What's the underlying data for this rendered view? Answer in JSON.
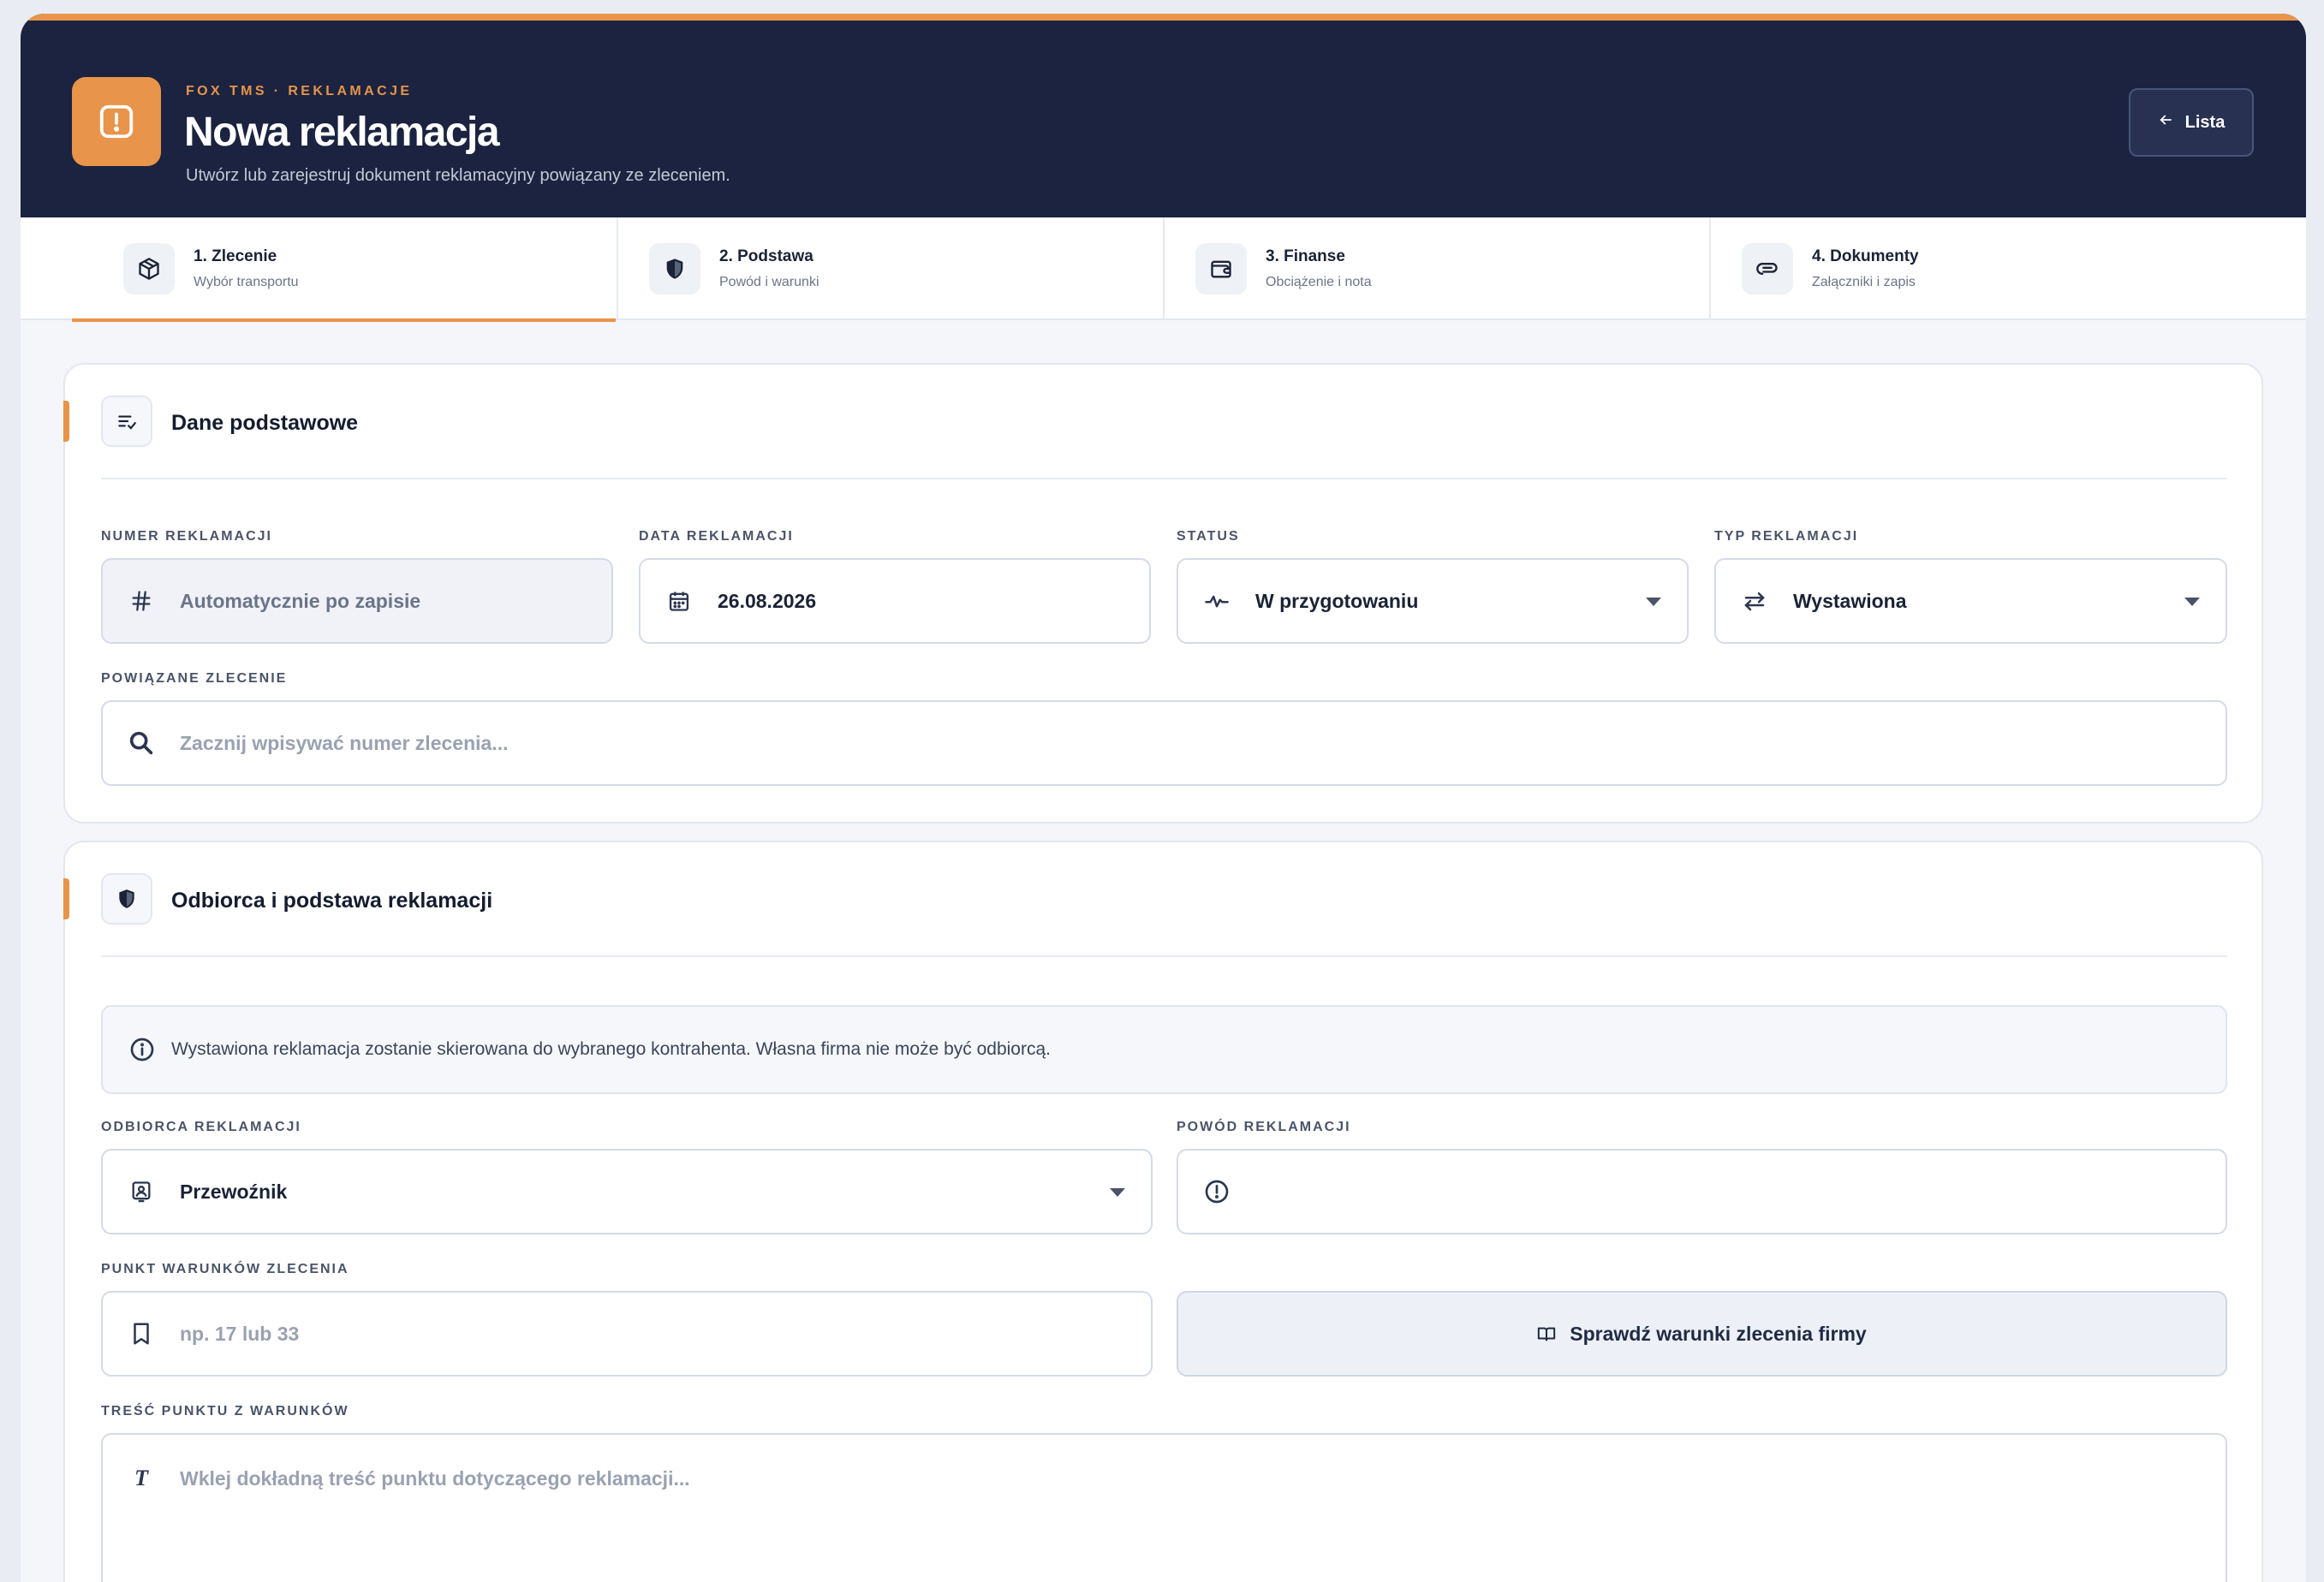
{
  "header": {
    "eyebrow": "FOX TMS · REKLAMACJE",
    "title": "Nowa reklamacja",
    "subtitle": "Utwórz lub zarejestruj dokument reklamacyjny powiązany ze zleceniem.",
    "back_button": {
      "icon": "arrow-left-icon",
      "label": "Lista"
    },
    "logo_icon": "alert-square-icon",
    "accent_color": "#e8944a",
    "background_color": "#1b2340"
  },
  "steps": [
    {
      "title": "1. Zlecenie",
      "subtitle": "Wybór transportu",
      "icon": "package-icon",
      "active": true
    },
    {
      "title": "2. Podstawa",
      "subtitle": "Powód i warunki",
      "icon": "shield-icon",
      "active": false
    },
    {
      "title": "3. Finanse",
      "subtitle": "Obciążenie i nota",
      "icon": "wallet-icon",
      "active": false
    },
    {
      "title": "4. Dokumenty",
      "subtitle": "Załączniki i zapis",
      "icon": "paperclip-icon",
      "active": false
    }
  ],
  "basic": {
    "title": "Dane podstawowe",
    "icon": "list-check-icon",
    "number": {
      "label": "NUMER REKLAMACJI",
      "value": "Automatycznie po zapisie",
      "icon": "hash-icon"
    },
    "date": {
      "label": "DATA REKLAMACJI",
      "value": "26.08.2026",
      "icon": "calendar-icon"
    },
    "status": {
      "label": "STATUS",
      "value": "W przygotowaniu",
      "icon": "activity-icon"
    },
    "type": {
      "label": "TYP REKLAMACJI",
      "value": "Wystawiona",
      "icon": "swap-arrows-icon"
    },
    "order": {
      "label": "POWIĄZANE ZLECENIE",
      "placeholder": "Zacznij wpisywać numer zlecenia...",
      "icon": "search-icon"
    }
  },
  "recipient": {
    "title": "Odbiorca i podstawa reklamacji",
    "icon": "shield-icon",
    "info": {
      "icon": "info-icon",
      "text": "Wystawiona reklamacja zostanie skierowana do wybranego kontrahenta. Własna firma nie może być odbiorcą."
    },
    "recipient_field": {
      "label": "ODBIORCA REKLAMACJI",
      "value": "Przewoźnik",
      "icon": "contact-icon"
    },
    "reason_field": {
      "label": "POWÓD REKLAMACJI",
      "value": "",
      "icon": "alert-circle-icon"
    },
    "point_field": {
      "label": "PUNKT WARUNKÓW ZLECENIA",
      "placeholder": "np. 17 lub 33",
      "icon": "bookmark-icon"
    },
    "check_button": {
      "label": "Sprawdź warunki zlecenia firmy",
      "icon": "book-icon"
    },
    "content_field": {
      "label": "TREŚĆ PUNKTU Z WARUNKÓW",
      "placeholder": "Wklej dokładną treść punktu dotyczącego reklamacji...",
      "icon": "text-icon"
    }
  }
}
